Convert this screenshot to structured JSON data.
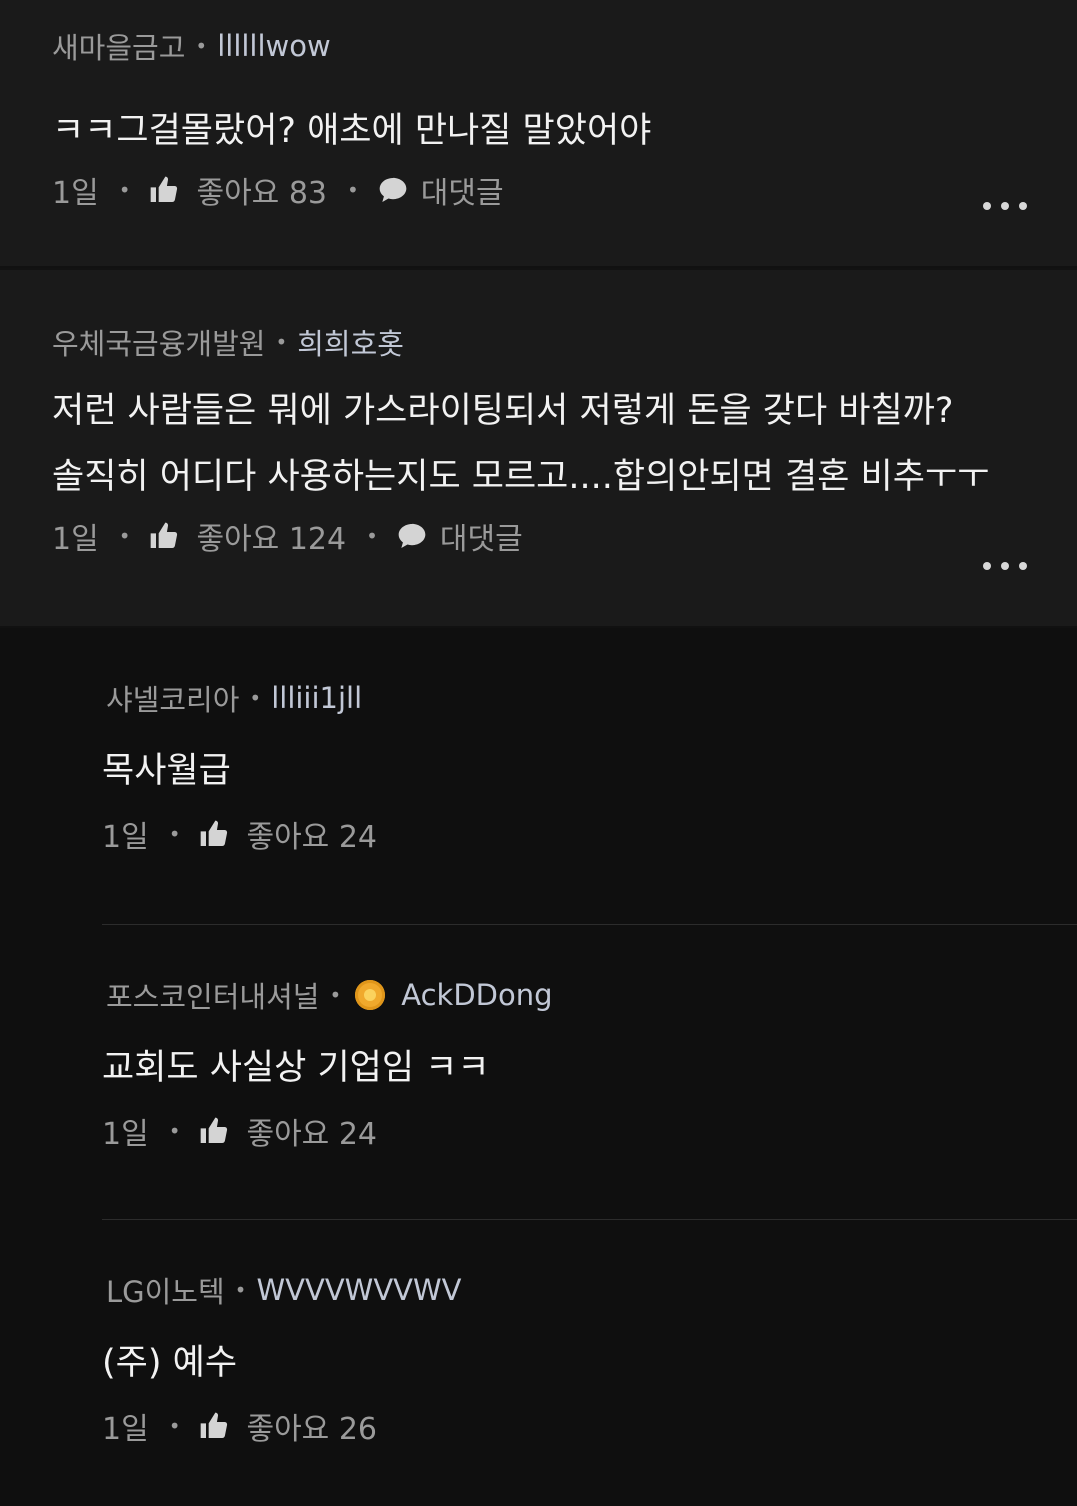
{
  "comments": [
    {
      "company": "새마을금고",
      "user": "llllllwow",
      "text": [
        "ㅋㅋ그걸몰랐어? 애초에 만나질 말았어야"
      ],
      "time": "1일",
      "like_label": "좋아요 83",
      "reply_label": "대댓글"
    },
    {
      "company": "우체국금융개발원",
      "user": "희희호홋",
      "text": [
        "저런 사람들은 뭐에 가스라이팅되서 저렇게 돈을 갖다 바칠까?",
        "솔직히 어디다 사용하는지도 모르고....합의안되면 결혼 비추ㅜㅜ"
      ],
      "time": "1일",
      "like_label": "좋아요 124",
      "reply_label": "대댓글"
    }
  ],
  "replies": [
    {
      "company": "샤넬코리아",
      "user": "llliii1jll",
      "text": "목사월급",
      "time": "1일",
      "like_label": "좋아요 24"
    },
    {
      "company": "포스코인터내셔널",
      "user": "AckDDong",
      "text": "교회도 사실상 기업임 ㅋㅋ",
      "time": "1일",
      "like_label": "좋아요 24"
    },
    {
      "company": "LG이노텍",
      "user": "WVVVWVVWV",
      "text": "(주) 예수",
      "time": "1일",
      "like_label": "좋아요 26"
    }
  ],
  "colors": {
    "background": "#0f0f0f",
    "top_comment_bg": "#1a1a1a",
    "muted_text": "#9a9a9a",
    "badge": "#f0a92c"
  },
  "icons": [
    "thumbs-up-icon",
    "speech-bubble-icon",
    "more-dots-icon",
    "medal-badge-icon"
  ]
}
